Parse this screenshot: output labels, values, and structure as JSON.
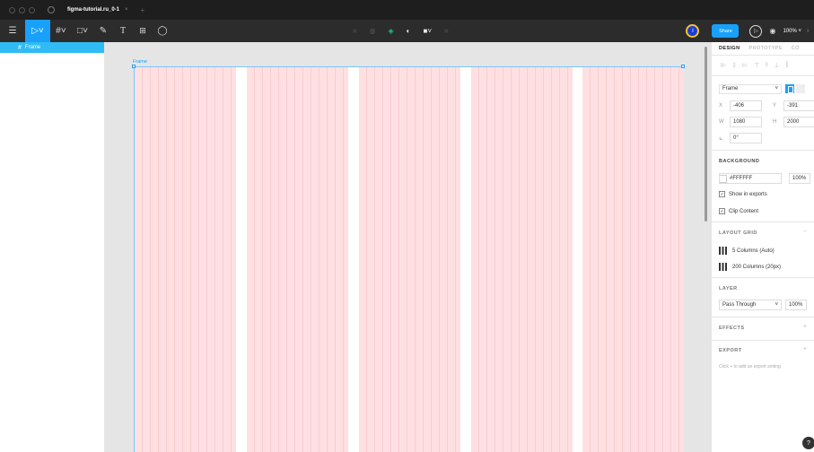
{
  "titlebar": {
    "tab_title": "figma-tutorial.ru_0-1",
    "tab_close": "×",
    "new_tab": "+"
  },
  "toolbar": {
    "menu_icon": "☰",
    "move_tool": "▷˅",
    "frame_tool": "#˅",
    "shape_tool": "□˅",
    "pen_tool": "✎",
    "text_tool": "T",
    "components_tool": "⊞",
    "comment_tool": "◯",
    "avatar_initial": "I",
    "share_label": "Share",
    "play_icon": "▷",
    "eye_icon": "◉",
    "zoom_label": "100% ˅",
    "more": "›"
  },
  "layers": {
    "items": [
      {
        "label": "Frame",
        "selected": true
      }
    ]
  },
  "canvas": {
    "frame_label": "Frame",
    "column_fill_color": "#ffe0e2",
    "grid_line_color": "#f4b8bd",
    "selection_color": "#18a0fb"
  },
  "properties": {
    "tabs": [
      "DESIGN",
      "PROTOTYPE",
      "CO"
    ],
    "frame_preset": "Frame",
    "x_label": "X",
    "x_value": "-406",
    "y_label": "Y",
    "y_value": "-391",
    "w_label": "W",
    "w_value": "1080",
    "h_label": "H",
    "h_value": "2000",
    "rotation_label": "⊾",
    "rotation_value": "0°",
    "background_title": "BACKGROUND",
    "background_hex": "#FFFFFF",
    "background_opacity": "100%",
    "show_in_exports": "Show in exports",
    "clip_content": "Clip Content",
    "layout_grid_title": "LAYOUT GRID",
    "grid_1": "5 Columns (Auto)",
    "grid_2": "200 Columns (20px)",
    "layer_title": "LAYER",
    "blend_mode": "Pass Through",
    "layer_opacity": "100%",
    "effects_title": "EFFECTS",
    "export_title": "EXPORT",
    "export_hint": "Click + to add an export setting",
    "check_mark": "✓",
    "dropdown_arrow": "˅",
    "minus": "−",
    "plus": "+"
  },
  "help": {
    "label": "?"
  }
}
